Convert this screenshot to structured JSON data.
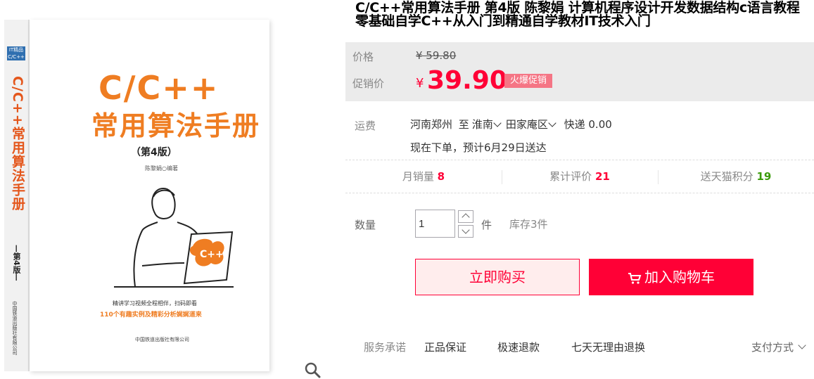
{
  "product_image": {
    "spine_badge": "IT精品 C/C++",
    "spine_title": "C/C++常用算法手册",
    "spine_edition": "—第4版—",
    "spine_publisher": "中国铁道出版社有限公司",
    "cover_title_line1": "C/C++",
    "cover_title_line2": "常用算法手册",
    "cover_edition": "（第4版）",
    "cover_author": "陈黎娟○编著",
    "cover_note_1": "精讲学习视频全程相伴，扫码即看",
    "cover_note_2": "110个有趣实例及精彩分析娓娓道来",
    "cover_publisher": "中国铁道出版社有限公司",
    "laptop_label": "C++"
  },
  "title": "C/C++常用算法手册 第4版 陈黎娟 计算机程序设计开发数据结构c语言教程零基础自学C++从入门到精通自学教材IT技术入门",
  "price": {
    "label": "价格",
    "original": "¥ 59.80",
    "promo_label": "促销价",
    "promo_currency": "¥",
    "promo_value": "39.90",
    "promo_badge": "火爆促销"
  },
  "shipping": {
    "label": "运费",
    "from": "河南郑州",
    "to_word": "至",
    "city": "淮南",
    "district": "田家庵区",
    "method": "快递 0.00",
    "eta": "现在下单，预计6月29日送达"
  },
  "stats": {
    "monthly_sales_label": "月销量",
    "monthly_sales": "8",
    "reviews_label": "累计评价",
    "reviews": "21",
    "points_label": "送天猫积分",
    "points": "19"
  },
  "quantity": {
    "label": "数量",
    "value": "1",
    "unit": "件",
    "stock": "库存3件"
  },
  "actions": {
    "buy_now": "立即购买",
    "add_to_cart": "加入购物车"
  },
  "service": {
    "label": "服务承诺",
    "items": [
      "正品保证",
      "极速退款",
      "七天无理由退换"
    ],
    "payment": "支付方式"
  },
  "colors": {
    "accent": "#ff0036",
    "badge": "#f57585",
    "points_green": "#3b9b0b",
    "cover_orange": "#ef7d22"
  },
  "icons": [
    "magnifier-icon",
    "chevron-down-icon",
    "cart-icon",
    "arrow-up-icon",
    "arrow-down-icon"
  ]
}
